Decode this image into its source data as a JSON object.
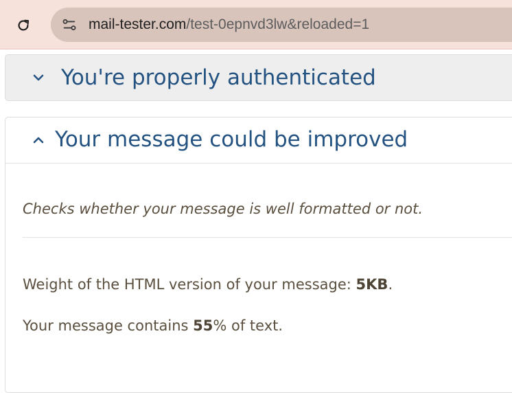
{
  "browser": {
    "url_host": "mail-tester.com",
    "url_path": "/test-0epnvd3lw&reloaded=1",
    "icons": {
      "reload": "reload-icon",
      "site_info": "site-settings-icon"
    }
  },
  "panels": {
    "authenticated": {
      "title": "You're properly authenticated",
      "chevron": "chevron-down-icon"
    },
    "improved": {
      "title": "Your message could be improved",
      "chevron": "chevron-up-icon",
      "description": "Checks whether your message is well formatted or not.",
      "weight": {
        "prefix": "Weight of the HTML version of your message: ",
        "value": "5KB",
        "suffix": "."
      },
      "text_ratio": {
        "prefix": "Your message contains ",
        "value": "55",
        "suffix": "% of text."
      }
    }
  },
  "colors": {
    "chrome_bg": "#f7e1db",
    "omnibox_bg": "#d9c4bc",
    "title_blue": "#245382",
    "body_text": "#5a4f3e"
  }
}
